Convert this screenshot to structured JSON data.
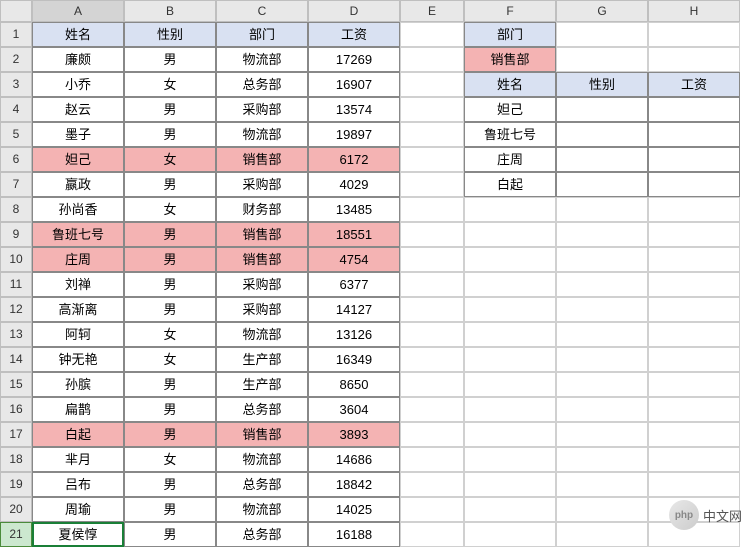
{
  "columns": [
    "",
    "A",
    "B",
    "C",
    "D",
    "E",
    "F",
    "G",
    "H"
  ],
  "rows": [
    1,
    2,
    3,
    4,
    5,
    6,
    7,
    8,
    9,
    10,
    11,
    12,
    13,
    14,
    15,
    16,
    17,
    18,
    19,
    20,
    21
  ],
  "selectedCell": "A21",
  "highlightRows": [
    6,
    9,
    10,
    17
  ],
  "mainHeaders": {
    "A": "姓名",
    "B": "性别",
    "C": "部门",
    "D": "工资"
  },
  "mainData": [
    {
      "A": "廉颇",
      "B": "男",
      "C": "物流部",
      "D": "17269"
    },
    {
      "A": "小乔",
      "B": "女",
      "C": "总务部",
      "D": "16907"
    },
    {
      "A": "赵云",
      "B": "男",
      "C": "采购部",
      "D": "13574"
    },
    {
      "A": "墨子",
      "B": "男",
      "C": "物流部",
      "D": "19897"
    },
    {
      "A": "妲己",
      "B": "女",
      "C": "销售部",
      "D": "6172"
    },
    {
      "A": "嬴政",
      "B": "男",
      "C": "采购部",
      "D": "4029"
    },
    {
      "A": "孙尚香",
      "B": "女",
      "C": "财务部",
      "D": "13485"
    },
    {
      "A": "鲁班七号",
      "B": "男",
      "C": "销售部",
      "D": "18551"
    },
    {
      "A": "庄周",
      "B": "男",
      "C": "销售部",
      "D": "4754"
    },
    {
      "A": "刘禅",
      "B": "男",
      "C": "采购部",
      "D": "6377"
    },
    {
      "A": "高渐离",
      "B": "男",
      "C": "采购部",
      "D": "14127"
    },
    {
      "A": "阿轲",
      "B": "女",
      "C": "物流部",
      "D": "13126"
    },
    {
      "A": "钟无艳",
      "B": "女",
      "C": "生产部",
      "D": "16349"
    },
    {
      "A": "孙膑",
      "B": "男",
      "C": "生产部",
      "D": "8650"
    },
    {
      "A": "扁鹊",
      "B": "男",
      "C": "总务部",
      "D": "3604"
    },
    {
      "A": "白起",
      "B": "男",
      "C": "销售部",
      "D": "3893"
    },
    {
      "A": "芈月",
      "B": "女",
      "C": "物流部",
      "D": "14686"
    },
    {
      "A": "吕布",
      "B": "男",
      "C": "总务部",
      "D": "18842"
    },
    {
      "A": "周瑜",
      "B": "男",
      "C": "物流部",
      "D": "14025"
    },
    {
      "A": "夏侯惇",
      "B": "男",
      "C": "总务部",
      "D": "16188"
    }
  ],
  "side": {
    "F1": "部门",
    "F2": "销售部",
    "F3": "姓名",
    "G3": "性别",
    "H3": "工资",
    "F4": "妲己",
    "F5": "鲁班七号",
    "F6": "庄周",
    "F7": "白起"
  },
  "watermark": "中文网",
  "watermarkIcon": "php"
}
